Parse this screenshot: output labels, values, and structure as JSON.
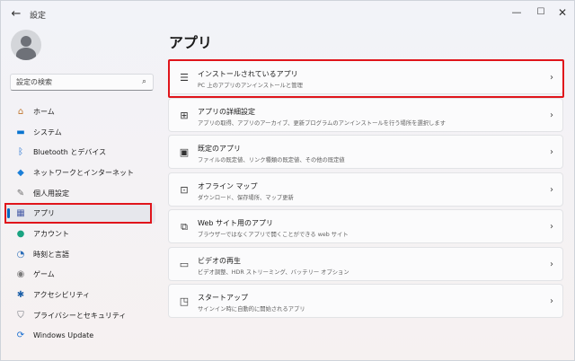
{
  "window": {
    "title": "設定",
    "back_icon": "arrow-left-icon",
    "controls": {
      "minimize": "—",
      "maximize": "☐",
      "close": "✕"
    }
  },
  "search": {
    "placeholder": "設定の検索",
    "icon": "search-icon"
  },
  "sidebar": {
    "selected_index": 5,
    "items": [
      {
        "label": "ホーム",
        "icon": "home-icon"
      },
      {
        "label": "システム",
        "icon": "monitor-icon"
      },
      {
        "label": "Bluetooth とデバイス",
        "icon": "bluetooth-icon"
      },
      {
        "label": "ネットワークとインターネット",
        "icon": "wifi-icon"
      },
      {
        "label": "個人用設定",
        "icon": "brush-icon"
      },
      {
        "label": "アプリ",
        "icon": "apps-icon"
      },
      {
        "label": "アカウント",
        "icon": "account-icon"
      },
      {
        "label": "時刻と言語",
        "icon": "globe-clock-icon"
      },
      {
        "label": "ゲーム",
        "icon": "gamepad-icon"
      },
      {
        "label": "アクセシビリティ",
        "icon": "accessibility-icon"
      },
      {
        "label": "プライバシーとセキュリティ",
        "icon": "shield-icon"
      },
      {
        "label": "Windows Update",
        "icon": "update-icon"
      }
    ]
  },
  "main": {
    "title": "アプリ",
    "cards": [
      {
        "title": "インストールされているアプリ",
        "desc": "PC 上のアプリのアンインストールと管理",
        "icon": "list-icon"
      },
      {
        "title": "アプリの詳細設定",
        "desc": "アプリの取得、アプリのアーカイブ、更新プログラムのアンインストールを行う場所を選択します",
        "icon": "app-settings-icon"
      },
      {
        "title": "既定のアプリ",
        "desc": "ファイルの既定値、リンク種類の既定値、その他の既定値",
        "icon": "default-apps-icon"
      },
      {
        "title": "オフライン マップ",
        "desc": "ダウンロード、保存場所、マップ更新",
        "icon": "map-icon"
      },
      {
        "title": "Web サイト用のアプリ",
        "desc": "ブラウザーではなくアプリで開くことができる web サイト",
        "icon": "web-apps-icon"
      },
      {
        "title": "ビデオの再生",
        "desc": "ビデオ調整、HDR ストリーミング、バッテリー オプション",
        "icon": "video-icon"
      },
      {
        "title": "スタートアップ",
        "desc": "サインイン時に自動的に開始されるアプリ",
        "icon": "startup-icon"
      }
    ]
  }
}
